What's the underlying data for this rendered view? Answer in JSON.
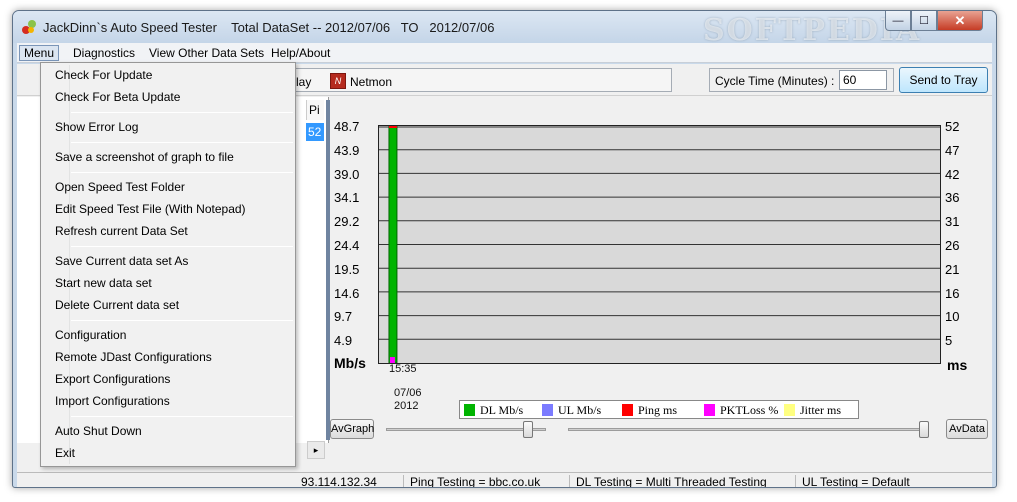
{
  "window": {
    "title": "JackDinn`s Auto Speed Tester    Total DataSet -- 2012/07/06   TO   2012/07/06",
    "watermark": "SOFTPEDIA",
    "minimize_glyph": "—",
    "maximize_glyph": "☐",
    "close_glyph": "✕"
  },
  "menubar": {
    "items": [
      "Menu",
      "Diagnostics",
      "View Other Data Sets",
      "Help/About"
    ],
    "active": "Menu"
  },
  "menu_dropdown": {
    "groups": [
      [
        "Check For Update",
        "Check For Beta Update"
      ],
      [
        "Show Error Log"
      ],
      [
        "Save a screenshot of graph to file"
      ],
      [
        "Open Speed Test Folder",
        "Edit Speed Test File (With Notepad)",
        "Refresh current Data Set"
      ],
      [
        "Save Current data set As",
        "Start new data set",
        "Delete Current data set"
      ],
      [
        "Configuration",
        "Remote JDast Configurations",
        "Export Configurations",
        "Import Configurations"
      ],
      [
        "Auto Shut Down",
        "Exit"
      ]
    ]
  },
  "toolbar": {
    "play_label": "lay",
    "netmon_icon": "netmon-icon",
    "netmon_label": "Netmon",
    "cycle_label": "Cycle Time (Minutes) :",
    "cycle_value": "60",
    "send_to_tray": "Send to Tray"
  },
  "left_panel": {
    "column_header": "Pi",
    "selected_value": "52"
  },
  "graph": {
    "left_unit": "Mb/s",
    "right_unit": "ms",
    "left_ticks": [
      "48.7",
      "43.9",
      "39.0",
      "34.1",
      "29.2",
      "24.4",
      "19.5",
      "14.6",
      "9.7",
      "4.9"
    ],
    "right_ticks": [
      "52",
      "47",
      "42",
      "36",
      "31",
      "26",
      "21",
      "16",
      "10",
      "5"
    ],
    "time_label": "15:35",
    "date_label": "07/06",
    "year_label": "2012",
    "av_graph": "AvGraph",
    "av_data": "AvData",
    "legend": [
      {
        "label": "DL Mb/s",
        "color": "#00b400"
      },
      {
        "label": "UL Mb/s",
        "color": "#7b7bff"
      },
      {
        "label": "Ping ms",
        "color": "#ff0000"
      },
      {
        "label": "PKTLoss %",
        "color": "#ff00ff"
      },
      {
        "label": "Jitter ms",
        "color": "#ffff80"
      }
    ]
  },
  "chart_data": {
    "type": "bar",
    "categories": [
      "15:35 07/06 2012"
    ],
    "series": [
      {
        "name": "DL Mb/s",
        "values": [
          48.7
        ]
      },
      {
        "name": "Ping ms",
        "values": [
          52
        ]
      }
    ],
    "ylim": [
      0,
      48.7
    ],
    "y2lim": [
      0,
      52
    ],
    "grid": true,
    "legend_position": "bottom"
  },
  "statusbar": {
    "ip_label": "93.114.132.34",
    "ping_testing": "Ping Testing = bbc.co.uk",
    "dl_testing": "DL Testing = Multi Threaded Testing",
    "ul_testing": "UL Testing = Default"
  },
  "colors": {
    "dl": "#00b400",
    "ping": "#ff0000",
    "selection": "#3399ff"
  }
}
